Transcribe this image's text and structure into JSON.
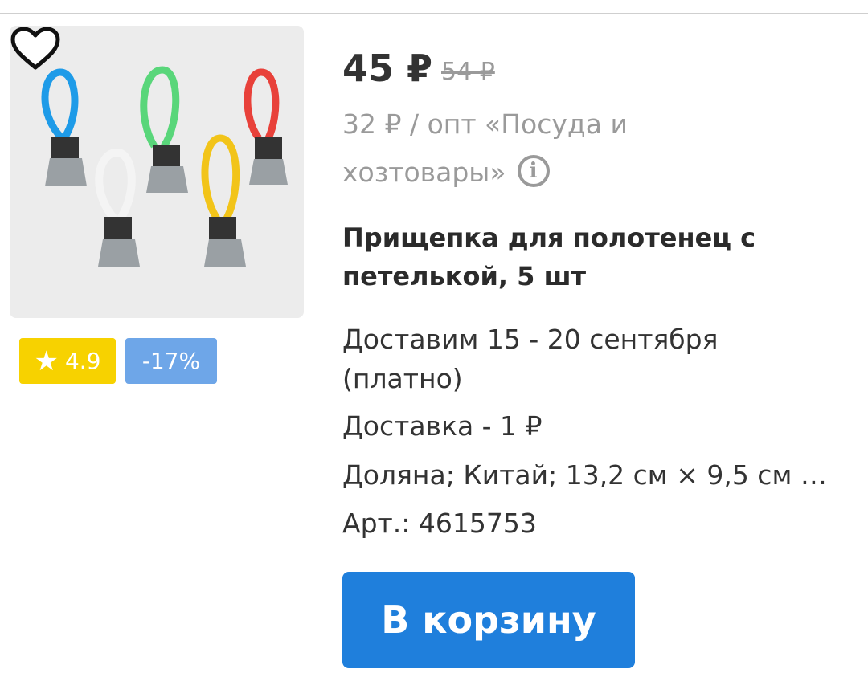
{
  "product": {
    "price": "45 ₽",
    "old_price": "54 ₽",
    "wholesale_line1": "32 ₽ / опт «Посуда и",
    "wholesale_line2": "хозтовары»",
    "title": "Прищепка для полотенец с петелькой, 5 шт",
    "delivery_date_line1": "Доставим 15 - 20 сентября",
    "delivery_date_line2": "(платно)",
    "delivery_cost": "Доставка - 1 ₽",
    "specs": "Доляна; Китай; 13,2 см × 9,5 см ×...",
    "article": "Арт.: 4615753"
  },
  "badges": {
    "rating": "4.9",
    "discount": "-17%"
  },
  "icons": {
    "rating": "star-icon",
    "favorite": "heart-icon",
    "info": "info-icon"
  },
  "actions": {
    "add_to_cart": "В корзину"
  },
  "colors": {
    "rating_badge": "#f7d200",
    "discount_badge": "#6ea6e8",
    "cart_button": "#1f7fdc"
  }
}
